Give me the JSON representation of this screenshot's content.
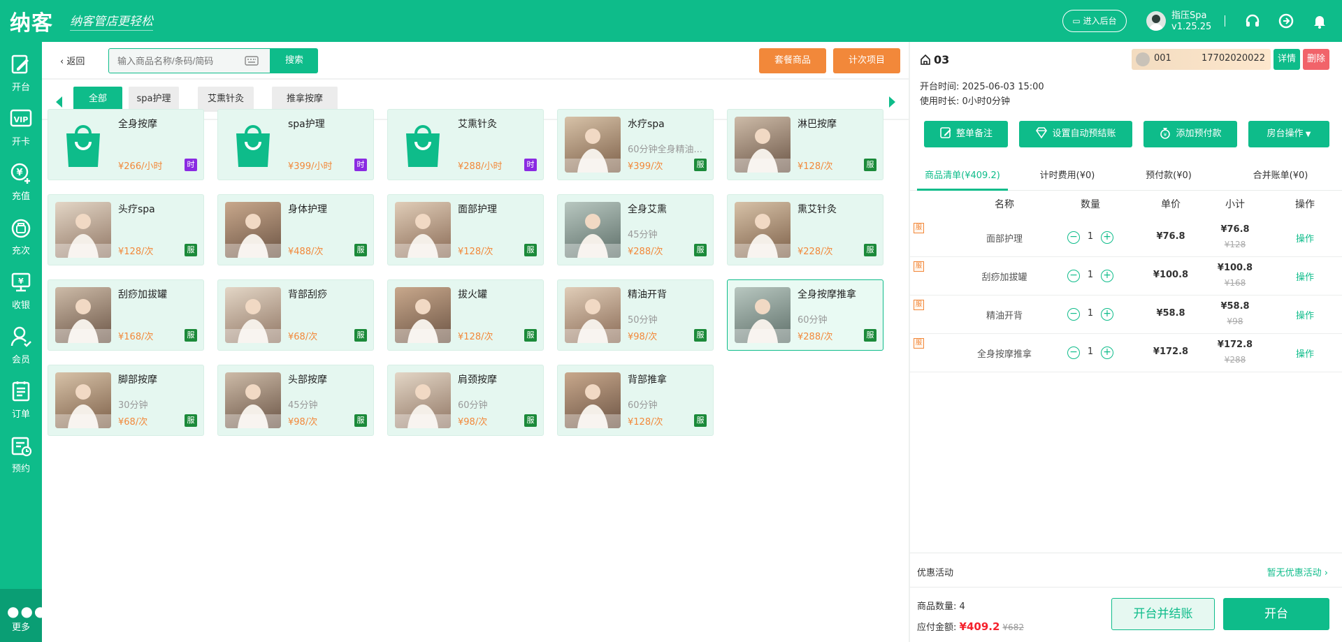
{
  "header": {
    "logo": "纳客",
    "slogan": "纳客管店更轻松",
    "enter_backend": "进入后台",
    "user_name": "指压Spa",
    "version": "v1.25.25"
  },
  "sidebar": {
    "items": [
      {
        "label": "开台",
        "icon": "edit-icon"
      },
      {
        "label": "开卡",
        "icon": "vip-card-icon"
      },
      {
        "label": "充值",
        "icon": "recharge-icon"
      },
      {
        "label": "充次",
        "icon": "count-recharge-icon"
      },
      {
        "label": "收银",
        "icon": "cashier-icon"
      },
      {
        "label": "会员",
        "icon": "member-icon"
      },
      {
        "label": "订单",
        "icon": "order-icon"
      },
      {
        "label": "预约",
        "icon": "booking-icon"
      }
    ],
    "more": "更多"
  },
  "toolbar": {
    "back": "返回",
    "search_placeholder": "输入商品名称/条码/简码",
    "search_btn": "搜索",
    "package_btn": "套餐商品",
    "count_btn": "计次项目"
  },
  "categories": [
    "全部",
    "spa护理",
    "艾熏针灸",
    "推拿按摩"
  ],
  "products": [
    {
      "name": "全身按摩",
      "desc": "",
      "price": "¥266/小时",
      "badge": "时"
    },
    {
      "name": "spa护理",
      "desc": "",
      "price": "¥399/小时",
      "badge": "时"
    },
    {
      "name": "艾熏针灸",
      "desc": "",
      "price": "¥288/小时",
      "badge": "时"
    },
    {
      "name": "水疗spa",
      "desc": "60分钟全身精油...",
      "price": "¥399/次",
      "badge": "服"
    },
    {
      "name": "淋巴按摩",
      "desc": "",
      "price": "¥128/次",
      "badge": "服"
    },
    {
      "name": "头疗spa",
      "desc": "",
      "price": "¥128/次",
      "badge": "服"
    },
    {
      "name": "身体护理",
      "desc": "",
      "price": "¥488/次",
      "badge": "服"
    },
    {
      "name": "面部护理",
      "desc": "",
      "price": "¥128/次",
      "badge": "服"
    },
    {
      "name": "全身艾熏",
      "desc": "45分钟",
      "price": "¥288/次",
      "badge": "服"
    },
    {
      "name": "熏艾针灸",
      "desc": "",
      "price": "¥228/次",
      "badge": "服"
    },
    {
      "name": "刮痧加拔罐",
      "desc": "",
      "price": "¥168/次",
      "badge": "服"
    },
    {
      "name": "背部刮痧",
      "desc": "",
      "price": "¥68/次",
      "badge": "服"
    },
    {
      "name": "拔火罐",
      "desc": "",
      "price": "¥128/次",
      "badge": "服"
    },
    {
      "name": "精油开背",
      "desc": "50分钟",
      "price": "¥98/次",
      "badge": "服"
    },
    {
      "name": "全身按摩推拿",
      "desc": "60分钟",
      "price": "¥288/次",
      "badge": "服"
    },
    {
      "name": "脚部按摩",
      "desc": "30分钟",
      "price": "¥68/次",
      "badge": "服"
    },
    {
      "name": "头部按摩",
      "desc": "45分钟",
      "price": "¥98/次",
      "badge": "服"
    },
    {
      "name": "肩颈按摩",
      "desc": "60分钟",
      "price": "¥98/次",
      "badge": "服"
    },
    {
      "name": "背部推拿",
      "desc": "60分钟",
      "price": "¥128/次",
      "badge": "服"
    }
  ],
  "room": {
    "number": "03",
    "open_time": "开台时间: 2025-06-03 15:00",
    "duration": "使用时长: 0小时0分钟",
    "member_id": "001",
    "member_phone": "17702020022",
    "detail_btn": "详情",
    "delete_btn": "删除"
  },
  "actions": [
    "整单备注",
    "设置自动预结账",
    "添加预付款",
    "房台操作"
  ],
  "order_tabs": [
    "商品清单(¥409.2)",
    "计时费用(¥0)",
    "预付款(¥0)",
    "合并账单(¥0)"
  ],
  "table_headers": [
    "名称",
    "数量",
    "单价",
    "小计",
    "操作"
  ],
  "order_items": [
    {
      "tag": "服",
      "name": "面部护理",
      "qty": "1",
      "unit": "¥76.8",
      "subtotal": "¥76.8",
      "original": "¥128",
      "op": "操作"
    },
    {
      "tag": "服",
      "name": "刮痧加拔罐",
      "qty": "1",
      "unit": "¥100.8",
      "subtotal": "¥100.8",
      "original": "¥168",
      "op": "操作"
    },
    {
      "tag": "服",
      "name": "精油开背",
      "qty": "1",
      "unit": "¥58.8",
      "subtotal": "¥58.8",
      "original": "¥98",
      "op": "操作"
    },
    {
      "tag": "服",
      "name": "全身按摩推拿",
      "qty": "1",
      "unit": "¥172.8",
      "subtotal": "¥172.8",
      "original": "¥288",
      "op": "操作"
    }
  ],
  "promo": {
    "label": "优惠活动",
    "value": "暂无优惠活动"
  },
  "summary": {
    "count": "商品数量: 4",
    "due_label": "应付金额:",
    "due_amount": "¥409.2",
    "due_original": "¥682",
    "settle_btn": "开台并结账",
    "open_btn": "开台"
  },
  "colors": {
    "primary": "#0ebc8a",
    "orange": "#f2883a",
    "red": "#f5222d",
    "time_badge": "#8a2be2",
    "service_badge": "#1b8a3a"
  }
}
